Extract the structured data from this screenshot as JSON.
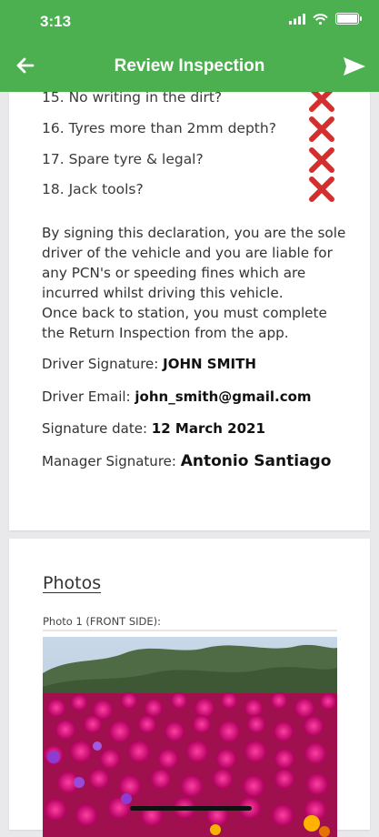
{
  "status_bar": {
    "time": "3:13"
  },
  "header": {
    "title": "Review Inspection"
  },
  "checklist": [
    {
      "label": "15. No writing in the dirt?",
      "result": "fail"
    },
    {
      "label": "16. Tyres more than 2mm depth?",
      "result": "fail"
    },
    {
      "label": "17. Spare tyre & legal?",
      "result": "fail"
    },
    {
      "label": "18. Jack tools?",
      "result": "fail"
    }
  ],
  "declaration": {
    "line1": "By signing this declaration, you are the sole",
    "line2": "driver of the vehicle and you are liable for",
    "line3": "any PCN's or speeding fines which are",
    "line4": "incurred whilst driving this vehicle.",
    "line5": "Once back to station, you must complete",
    "line6": "the Return Inspection from the app."
  },
  "signatures": {
    "driver_label": "Driver Signature:",
    "driver_value": "JOHN SMITH",
    "email_label": "Driver Email:",
    "email_value": "john_smith@gmail.com",
    "date_label": "Signature date:",
    "date_value": "12 March 2021",
    "manager_label": "Manager Signature:",
    "manager_value": "Antonio Santiago"
  },
  "photos": {
    "heading": "Photos",
    "items": [
      {
        "label": "Photo 1 (FRONT SIDE):"
      }
    ]
  },
  "colors": {
    "header_bg": "#4caf50",
    "fail_mark": "#d32f2f"
  }
}
